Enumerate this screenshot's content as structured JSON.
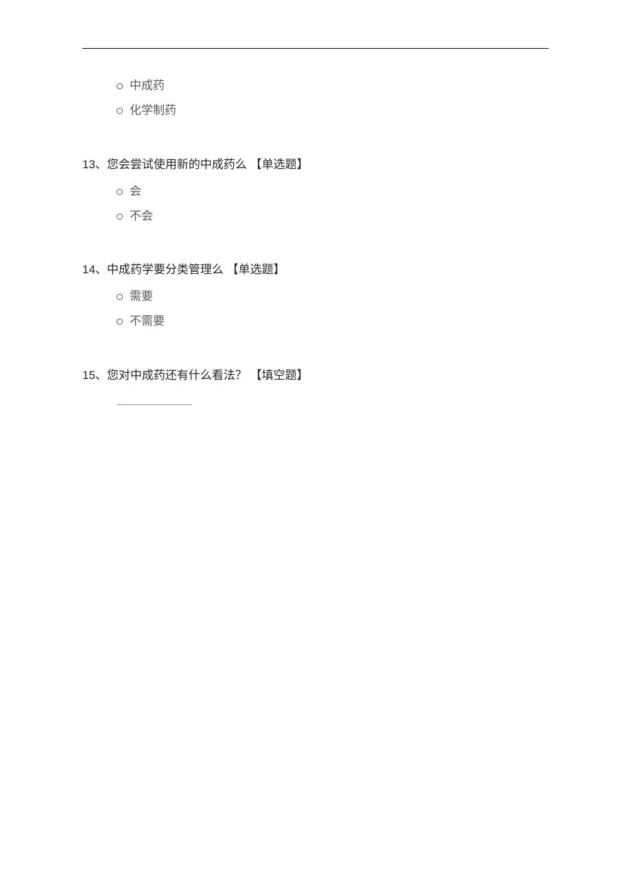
{
  "initial_options": [
    "中成药",
    "化学制药"
  ],
  "questions": [
    {
      "number": "13、",
      "text": "您会尝试使用新的中成药么 ",
      "type": "【单选题】",
      "options": [
        "会",
        "不会"
      ]
    },
    {
      "number": "14、",
      "text": "中成药学要分类管理么 ",
      "type": "【单选题】",
      "options": [
        "需要",
        "不需要"
      ]
    },
    {
      "number": "15、",
      "text": "您对中成药还有什么看法？ ",
      "type": "【填空题】",
      "fill": true
    }
  ]
}
